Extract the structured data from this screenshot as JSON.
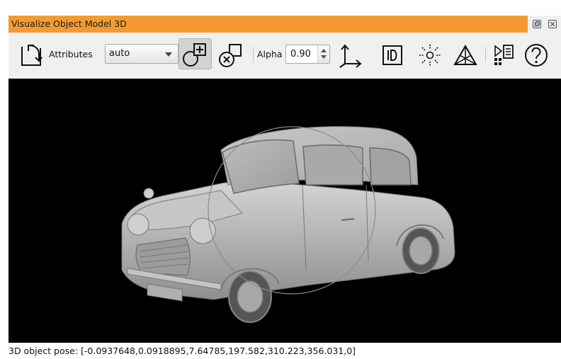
{
  "window": {
    "title": "Visualize Object Model 3D"
  },
  "icons": {
    "float": "float-window-icon",
    "close": "close-window-icon",
    "reset_pose": "reset-pose-icon",
    "add_object": "add-object-icon",
    "remove_object": "remove-object-icon",
    "axes": "axes-icon",
    "show_id": "id-icon",
    "light": "light-icon",
    "triangles": "triangle-mesh-icon",
    "attributes_panel": "attribute-panel-icon",
    "help": "help-icon"
  },
  "toolbar": {
    "attributes_label": "Attributes",
    "attributes_value": "auto",
    "alpha_label": "Alpha",
    "alpha_value": "0.90"
  },
  "status": {
    "pose_text": "3D object pose: [-0.0937648,0.0918895,7.64785,197.582,310.223,356.031,0]"
  },
  "colors": {
    "title_bar": "#f39b31",
    "viewport_background": "#000000",
    "model_color": "#b8b8b8"
  }
}
